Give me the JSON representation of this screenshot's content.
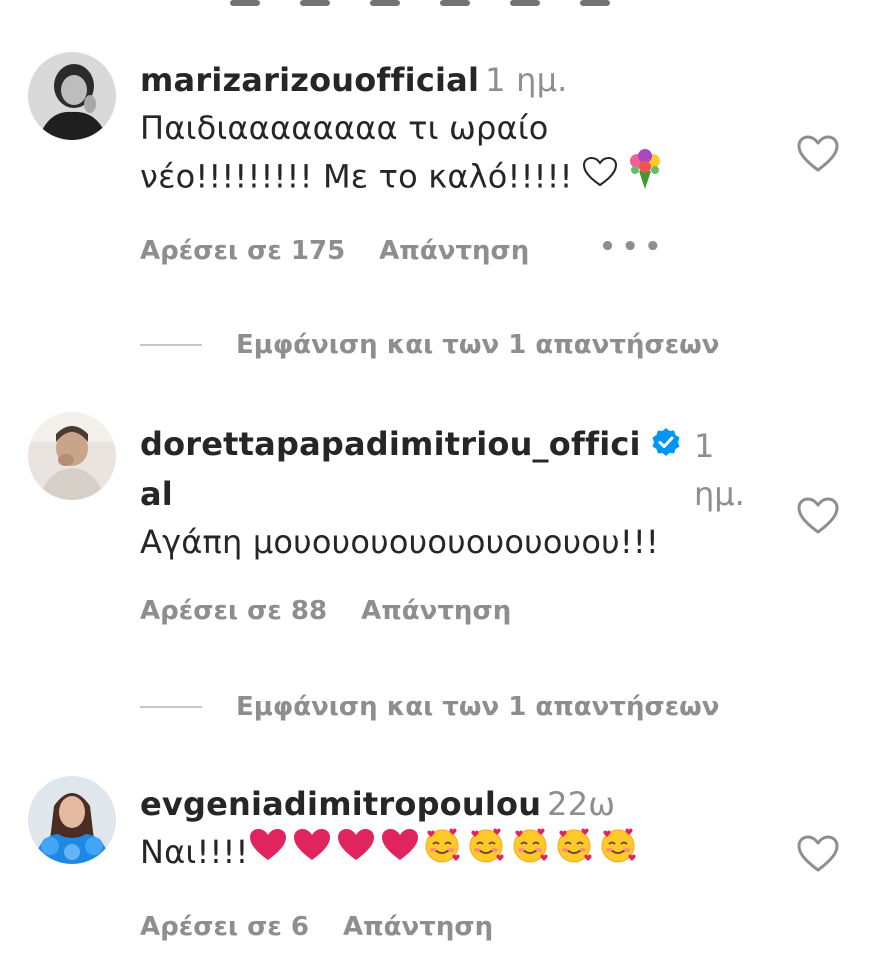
{
  "comments": [
    {
      "username": "marizarizouofficial",
      "time": "1 ημ.",
      "text_line1": "Παιδιαααααααα τι ωραίο",
      "text_line2": "νέο!!!!!!!!! Με το καλό!!!!!",
      "emojis": [
        "white-heart-emoji",
        "bouquet-emoji"
      ],
      "likes": "Αρέσει σε 175",
      "reply": "Απάντηση",
      "more": "•••",
      "view_replies": "Εμφάνιση και των 1 απαντήσεων"
    },
    {
      "username_line1": "dorettapapadimitriou_offici",
      "username_line2": "al",
      "verified": true,
      "time_line1": "1",
      "time_line2": "ημ.",
      "text": "Αγάπη μουουουουουουουουου!!!",
      "likes": "Αρέσει σε 88",
      "reply": "Απάντηση",
      "view_replies": "Εμφάνιση και των 1 απαντήσεων"
    },
    {
      "username": "evgeniadimitropoulou",
      "time": "22ω",
      "text": "Ναι!!!!",
      "emojis": [
        "red-heart-emoji",
        "red-heart-emoji",
        "red-heart-emoji",
        "red-heart-emoji",
        "smiling-face-with-hearts-emoji",
        "smiling-face-with-hearts-emoji",
        "smiling-face-with-hearts-emoji",
        "smiling-face-with-hearts-emoji",
        "smiling-face-with-hearts-emoji"
      ],
      "likes": "Αρέσει σε 6",
      "reply": "Απάντηση"
    }
  ],
  "colors": {
    "text": "#262626",
    "secondary": "#8e8e8e",
    "verified": "#0095f6",
    "heart_red": "#e0245e"
  }
}
